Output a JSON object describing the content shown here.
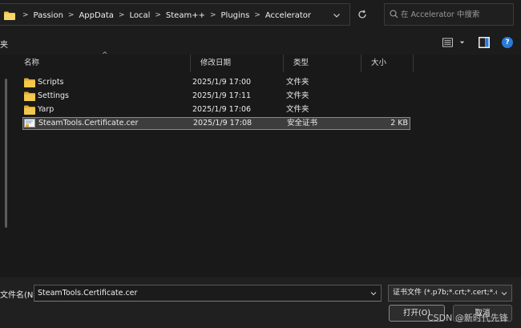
{
  "address_bar": {
    "crumbs": [
      "Passion",
      "AppData",
      "Local",
      "Steam++",
      "Plugins",
      "Accelerator"
    ],
    "separator": ">"
  },
  "search": {
    "placeholder": "在 Accelerator 中搜索"
  },
  "command_bar": {
    "left_label": "夹"
  },
  "help": {
    "label": "?"
  },
  "columns": {
    "name": "名称",
    "date": "修改日期",
    "type": "类型",
    "size": "大小"
  },
  "files": [
    {
      "name": "Scripts",
      "date": "2025/1/9 17:00",
      "type": "文件夹",
      "size": "",
      "icon": "folder-icon"
    },
    {
      "name": "Settings",
      "date": "2025/1/9 17:11",
      "type": "文件夹",
      "size": "",
      "icon": "folder-icon"
    },
    {
      "name": "Yarp",
      "date": "2025/1/9 17:06",
      "type": "文件夹",
      "size": "",
      "icon": "folder-icon"
    },
    {
      "name": "SteamTools.Certificate.cer",
      "date": "2025/1/9 17:08",
      "type": "安全证书",
      "size": "2 KB",
      "icon": "certificate-icon",
      "selected": true
    }
  ],
  "bottom": {
    "filename_label": "文件名(N):",
    "filename_value": "SteamTools.Certificate.cer",
    "filter": "证书文件 (*.p7b;*.crt;*.cert;*.c",
    "open_label": "打开(O)",
    "cancel_label": "取消",
    "watermark": "CSDN @新时代先锋"
  },
  "colors": {
    "background": "#191919",
    "folder": "#f2c94c",
    "selection": "#3d3d3d",
    "accent": "#2b7bd6"
  }
}
